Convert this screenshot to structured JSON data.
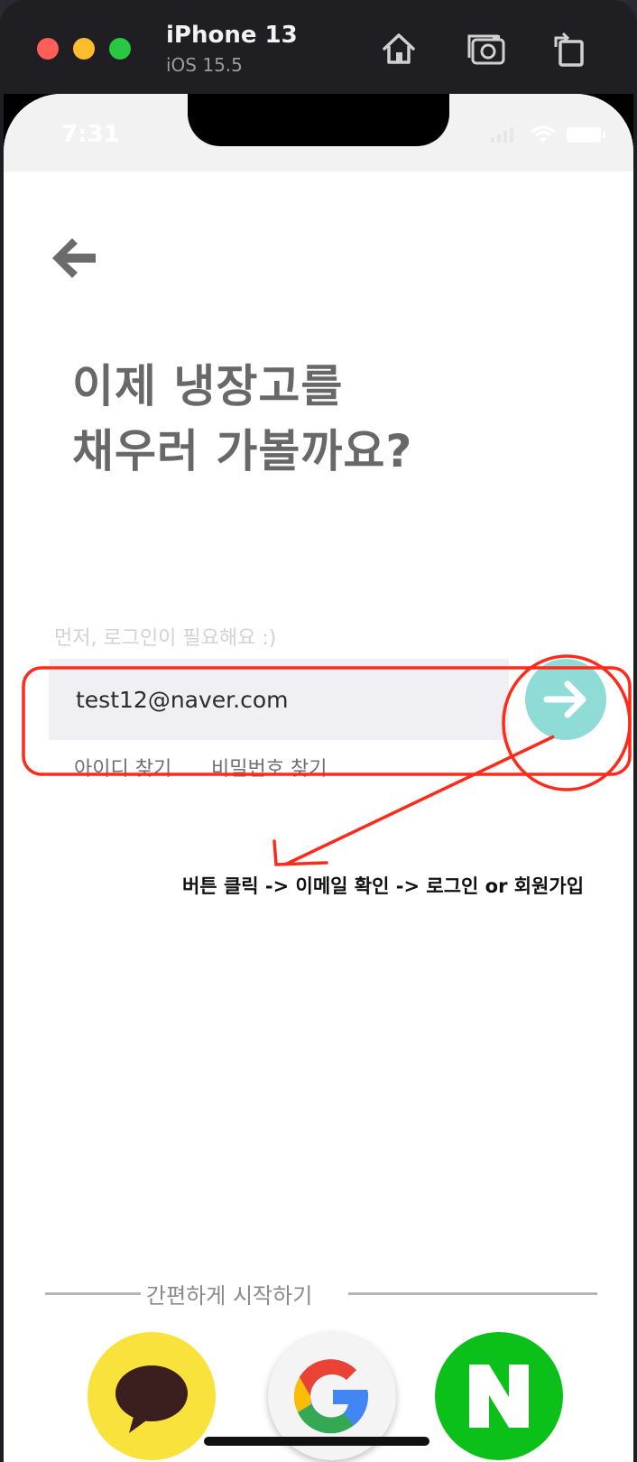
{
  "window": {
    "device_name": "iPhone 13",
    "os_version": "iOS 15.5"
  },
  "status_bar": {
    "time": "7:31"
  },
  "screen": {
    "headline_line1": "이제 냉장고를",
    "headline_line2": "채우러 가볼까요?",
    "login_hint": "먼저, 로그인이 필요해요 :)",
    "email_value": "test12@naver.com",
    "find_id": "아이디 찾기",
    "find_password": "비밀번호 찾기",
    "social_divider": "간편하게 시작하기",
    "social_logins": [
      "kakao",
      "google",
      "naver"
    ]
  },
  "annotation": {
    "note": "버튼 클릭 -> 이메일 확인 -> 로그인 or 회원가입"
  },
  "colors": {
    "accent_button": "#8fdcd6",
    "kakao": "#fae23c",
    "naver": "#0bc018",
    "annotation_red": "#ff2a1a"
  }
}
